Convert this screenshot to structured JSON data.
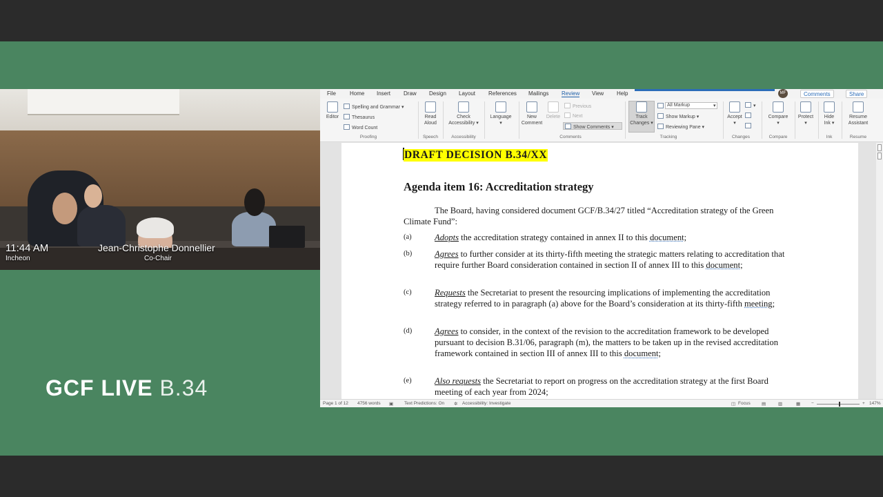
{
  "video": {
    "time": "11:44 AM",
    "location": "Incheon",
    "speaker_name": "Jean-Christophe Donnellier",
    "speaker_role": "Co-Chair",
    "nameplate_line1": "JEAN-CHRISTOPHE",
    "nameplate_line2": "DONNELLIER",
    "nameplate_line3": "CO-CHAIR"
  },
  "branding": {
    "brand": "GCF LIVE",
    "session": "B.34"
  },
  "word": {
    "menu": [
      "File",
      "Home",
      "Insert",
      "Draw",
      "Design",
      "Layout",
      "References",
      "Mailings",
      "Review",
      "View",
      "Help"
    ],
    "active_menu": "Review",
    "avatar_initials": "MF",
    "comments_button": "Comments",
    "share_button": "Share",
    "ribbon": {
      "editor": "Editor",
      "spelling": "Spelling and Grammar",
      "thesaurus": "Thesaurus",
      "word_count": "Word Count",
      "proofing_group": "Proofing",
      "read_aloud_1": "Read",
      "read_aloud_2": "Aloud",
      "speech_group": "Speech",
      "check_1": "Check",
      "check_2": "Accessibility",
      "accessibility_group": "Accessibility",
      "language": "Language",
      "new_comment_1": "New",
      "new_comment_2": "Comment",
      "delete": "Delete",
      "previous": "Previous",
      "next": "Next",
      "show_comments": "Show Comments",
      "comments_group": "Comments",
      "track_1": "Track",
      "track_2": "Changes",
      "markup_select": "All Markup",
      "show_markup": "Show Markup",
      "reviewing_pane": "Reviewing Pane",
      "tracking_group": "Tracking",
      "accept": "Accept",
      "changes_group": "Changes",
      "compare": "Compare",
      "compare_group": "Compare",
      "protect": "Protect",
      "hide_ink_1": "Hide",
      "hide_ink_2": "Ink",
      "ink_group": "Ink",
      "resume_1": "Resume",
      "resume_2": "Assistant",
      "resume_group": "Resume"
    },
    "document": {
      "draft_title": "DRAFT DECISION B.34/XX",
      "agenda_title": "Agenda item 16:  Accreditation strategy",
      "intro": "The Board, having considered document GCF/B.34/27 titled “Accreditation strategy of the Green Climate Fund”:",
      "items": [
        {
          "label": "(a)",
          "verb": "Adopts",
          "rest_a": " the accreditation strategy contained in annex II to this ",
          "squig": "document",
          "rest_b": ";"
        },
        {
          "label": "(b)",
          "verb": "Agrees",
          "rest_a": " to further consider at its thirty-fifth meeting the strategic matters relating to accreditation that require further Board consideration contained in section II of annex III to this ",
          "squig": "document",
          "rest_b": ";"
        },
        {
          "label": "(c)",
          "verb": "Requests",
          "rest_a": " the Secretariat to present the resourcing implications of implementing the accreditation strategy referred to in paragraph (a) above for the Board’s consideration at its thirty-fifth ",
          "squig": "meeting",
          "rest_b": ";"
        },
        {
          "label": "(d)",
          "verb": "Agrees",
          "rest_a": " to consider, in the context of the revision to the accreditation framework to be developed pursuant to decision B.31/06, paragraph (m), the matters to be taken up in the revised accreditation framework contained in section III of annex III to this ",
          "squig": "document",
          "rest_b": ";"
        },
        {
          "label": "(e)",
          "verb": "Also requests",
          "rest_a": " the Secretariat to report on progress on the accreditation strategy at the first Board meeting of each year from 2024;",
          "squig": "",
          "rest_b": ""
        }
      ]
    },
    "status": {
      "page": "Page 1 of 12",
      "words": "4756 words",
      "predictions": "Text Predictions: On",
      "accessibility": "Accessibility: Investigate",
      "focus": "Focus",
      "zoom": "147%"
    }
  }
}
